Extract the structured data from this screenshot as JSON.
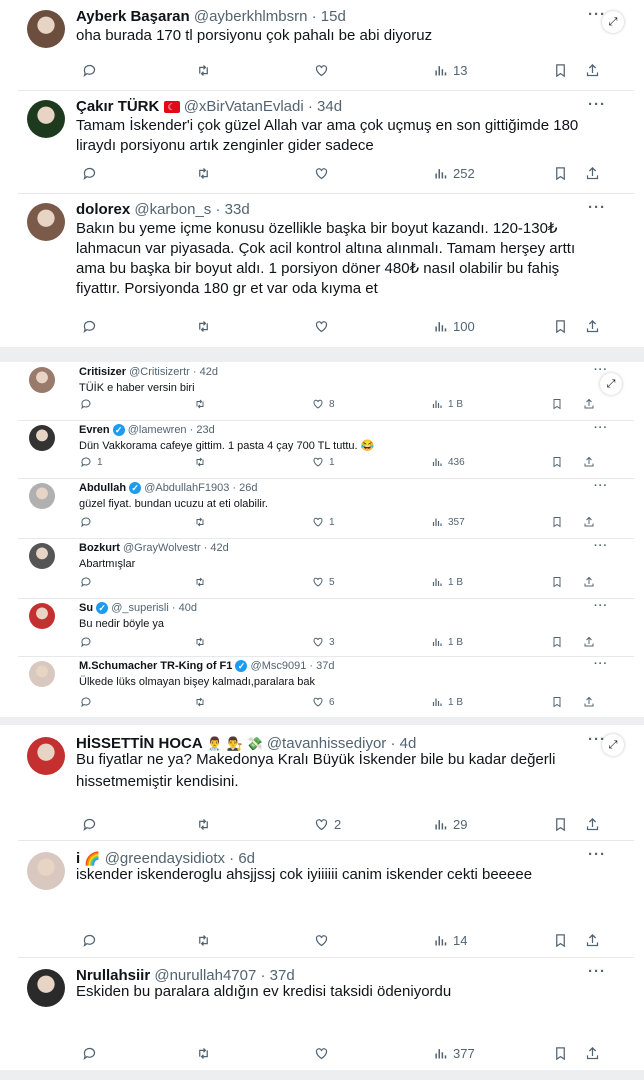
{
  "colors": {
    "text": "#0f1419",
    "muted": "#536471",
    "divider": "#e6e9eb",
    "verified": "#1d9bf0",
    "gap": "#eceef0"
  },
  "groups": [
    {
      "tweets": [
        {
          "name": "Ayberk Başaran",
          "handle": "@ayberkhlmbsrn",
          "time": "· 15d",
          "text": "oha burada 170 tl porsiyonu çok pahalı be abi diyoruz",
          "reply": "",
          "retweet": "",
          "like": "",
          "views": "13"
        },
        {
          "name": "Çakır TÜRK",
          "flag": "☾",
          "handle": "@xBirVatanEvladi",
          "time": "· 34d",
          "text": "Tamam İskender'i çok güzel Allah var ama çok uçmuş en son gittiğimde 180 liraydı porsiyonu artık zenginler gider sadece",
          "reply": "",
          "retweet": "",
          "like": "",
          "views": "252"
        },
        {
          "name": "dolorex",
          "handle": "@karbon_s",
          "time": "· 33d",
          "text": "Bakın bu yeme içme konusu özellikle başka bir boyut kazandı. 120-130₺ lahmacun var piyasada. Çok acil kontrol altına alınmalı. Tamam herşey arttı ama bu başka bir boyut aldı. 1 porsiyon döner 480₺ nasıl olabilir bu fahiş fiyattır. Porsiyonda 180 gr et var oda kıyma et",
          "reply": "",
          "retweet": "",
          "like": "",
          "views": "100"
        }
      ]
    },
    {
      "tweets": [
        {
          "name": "Critisizer",
          "handle": "@Critisizertr",
          "time": "· 42d",
          "text": "TÜİK e haber versin biri",
          "reply": "",
          "retweet": "",
          "like": "8",
          "views": "1 B"
        },
        {
          "name": "Evren",
          "verified": "✓",
          "handle": "@lamewren",
          "time": "· 23d",
          "text": "Dün Vakkorama cafeye gittim. 1 pasta 4 çay 700 TL tuttu. 😂",
          "reply": "1",
          "retweet": "",
          "like": "1",
          "views": "436"
        },
        {
          "name": "Abdullah",
          "verified": "✓",
          "handle": "@AbdullahF1903",
          "time": "· 26d",
          "text": "güzel fiyat.  bundan ucuzu at eti olabilir.",
          "reply": "",
          "retweet": "",
          "like": "1",
          "views": "357"
        },
        {
          "name": "Bozkurt",
          "handle": "@GrayWolvestr",
          "time": "· 42d",
          "text": "Abartmışlar",
          "reply": "",
          "retweet": "",
          "like": "5",
          "views": "1 B"
        },
        {
          "name": "Su",
          "verified": "✓",
          "handle": "@_superisli",
          "time": "· 40d",
          "text": "Bu nedir böyle ya",
          "reply": "",
          "retweet": "",
          "like": "3",
          "views": "1 B"
        },
        {
          "name": "M.Schumacher TR-King of F1",
          "verified": "✓",
          "handle": "@Msc9091",
          "time": "· 37d",
          "text": "Ülkede lüks olmayan bişey kalmadı,paralara bak",
          "reply": "",
          "retweet": "",
          "like": "6",
          "views": "1 B"
        }
      ]
    },
    {
      "tweets": [
        {
          "name": "HİSSETTİN HOCA",
          "emoji": "👨‍⚕️ 👨‍⚖️ 💸",
          "handle": "@tavanhissediyor",
          "time": "· 4d",
          "text": "Bu fiyatlar ne ya? Makedonya Kralı Büyük İskender bile bu kadar değerli hissetmemiştir kendisini.",
          "reply": "",
          "retweet": "",
          "like": "2",
          "views": "29"
        },
        {
          "name": "i",
          "emoji": "🌈",
          "handle": "@greendaysidiotx",
          "time": "· 6d",
          "text": "iskender iskenderoglu ahsjjssj cok iyiiiiii canim iskender cekti beeeee",
          "reply": "",
          "retweet": "",
          "like": "",
          "views": "14"
        },
        {
          "name": "Nrullahsiir",
          "handle": "@nurullah4707",
          "time": "· 37d",
          "text": "Eskiden bu paralara aldığın ev kredisi taksidi ödeniyordu",
          "reply": "",
          "retweet": "",
          "like": "",
          "views": "377"
        }
      ]
    }
  ],
  "icons": {
    "more": "more-icon",
    "expand": "expand-icon",
    "reply": "reply-icon",
    "retweet": "retweet-icon",
    "like": "like-icon",
    "views": "views-icon",
    "bookmark": "bookmark-icon",
    "share": "share-icon"
  }
}
